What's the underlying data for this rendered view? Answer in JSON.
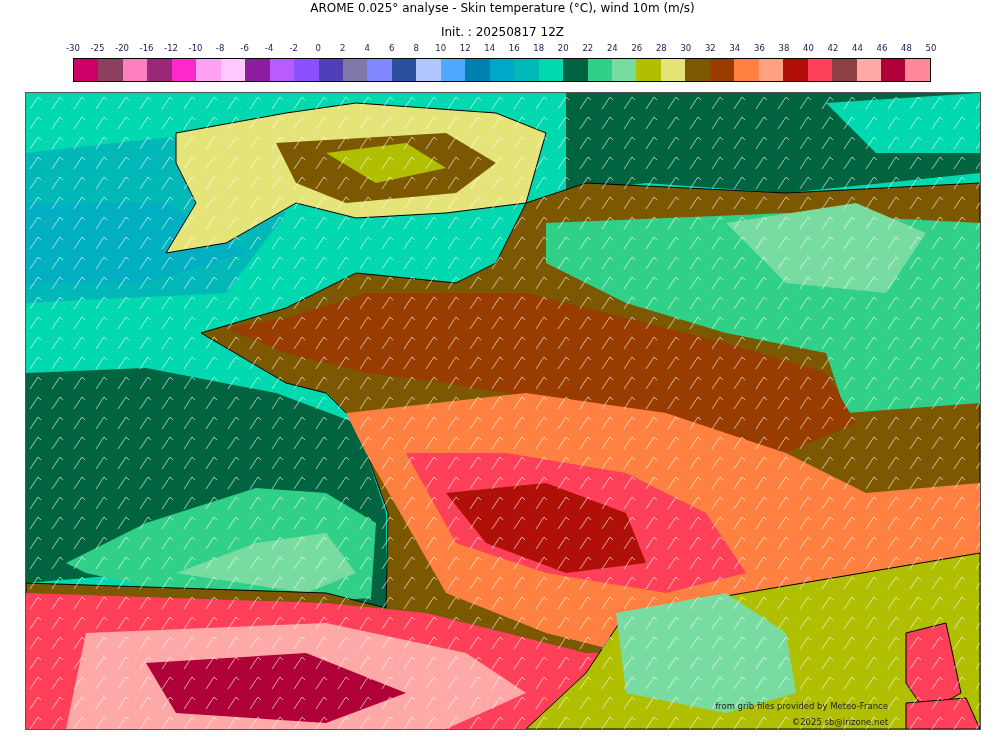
{
  "title": "AROME 0.025° analyse - Skin temperature (°C), wind 10m (m/s)",
  "subtitle": "Init. : 20250817 12Z",
  "colorbar": {
    "ticks": [
      "-30",
      "-25",
      "-20",
      "-16",
      "-12",
      "-10",
      "-8",
      "-6",
      "-4",
      "-2",
      "0",
      "2",
      "4",
      "6",
      "8",
      "10",
      "12",
      "14",
      "16",
      "18",
      "20",
      "22",
      "24",
      "26",
      "28",
      "30",
      "32",
      "34",
      "36",
      "38",
      "40",
      "42",
      "44",
      "46",
      "48",
      "50"
    ],
    "swatches": [
      {
        "color": "#cc0066"
      },
      {
        "color": "#8b4060"
      },
      {
        "color": "#ff80c0"
      },
      {
        "color": "#9a2878"
      },
      {
        "color": "#ff28c8"
      },
      {
        "color": "#ffa0f0"
      },
      {
        "color": "#ffc8ff"
      },
      {
        "color": "#8c1ca0"
      },
      {
        "color": "#b85cff"
      },
      {
        "color": "#8c50ff"
      },
      {
        "color": "#5040b8"
      },
      {
        "color": "#8078a8"
      },
      {
        "color": "#8088ff"
      },
      {
        "color": "#2c50a0"
      },
      {
        "color": "#b0c8ff"
      },
      {
        "color": "#50a8ff"
      },
      {
        "color": "#0080b0"
      },
      {
        "color": "#00a8c8"
      },
      {
        "color": "#00b8b8"
      },
      {
        "color": "#00d8b0"
      },
      {
        "color": "#006440"
      },
      {
        "color": "#30d088"
      },
      {
        "color": "#78dca0"
      },
      {
        "color": "#b0c000"
      },
      {
        "color": "#e4e478"
      },
      {
        "color": "#7c5800"
      },
      {
        "color": "#983c00"
      },
      {
        "color": "#ff8040"
      },
      {
        "color": "#ffa080"
      },
      {
        "color": "#b01008"
      },
      {
        "color": "#ff4058"
      },
      {
        "color": "#8c4044"
      },
      {
        "color": "#ffa8a8"
      },
      {
        "color": "#b00038"
      },
      {
        "color": "#ff8898"
      }
    ]
  },
  "map": {
    "credits": [
      "from grib files provided by Meteo-France",
      "©2025 sb@irizone.net"
    ]
  }
}
